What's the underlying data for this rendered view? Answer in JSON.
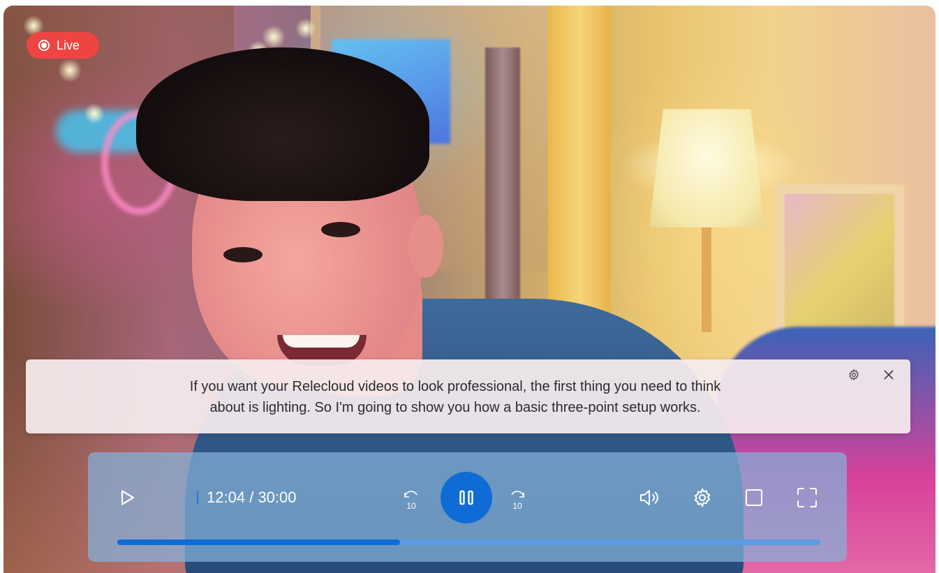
{
  "live_badge": {
    "label": "Live",
    "color": "#ef4444"
  },
  "caption": {
    "line1": "If you want your Relecloud videos to look professional, the first thing you need to think",
    "line2": "about is lighting. So I'm going to show you how a basic three-point setup works.",
    "settings_icon": "gear-icon",
    "close_icon": "close-icon"
  },
  "player": {
    "current_time": "12:04",
    "separator": "/",
    "duration": "30:00",
    "progress_fraction": 0.402,
    "accent_color": "#0f6cd6",
    "controls": {
      "play_icon": "play-icon",
      "rewind_label": "10",
      "rewind_icon": "rewind-10-icon",
      "pause_icon": "pause-icon",
      "forward_label": "10",
      "forward_icon": "forward-10-icon",
      "volume_icon": "volume-icon",
      "settings_icon": "gear-icon",
      "miniplayer_icon": "square-icon",
      "fullscreen_icon": "fullscreen-icon"
    }
  }
}
